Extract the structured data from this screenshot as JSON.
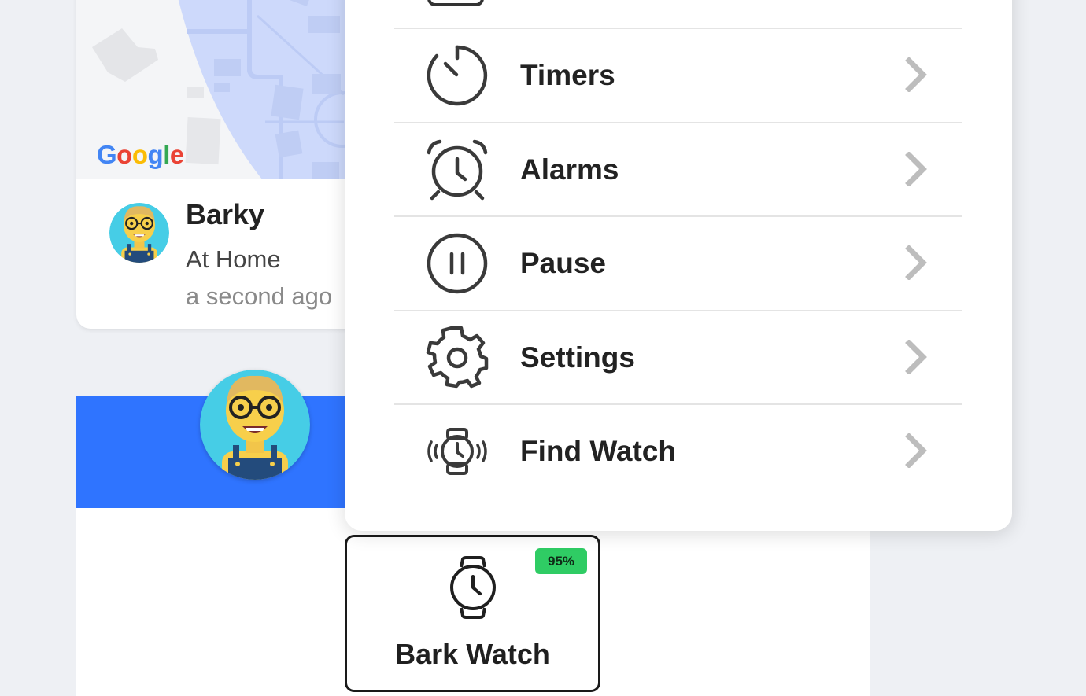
{
  "location_card": {
    "map_provider": "Google",
    "person_name": "Barky",
    "status": "At Home",
    "updated": "a second ago"
  },
  "menu": {
    "items": [
      {
        "label": "Timers",
        "icon": "timer-icon"
      },
      {
        "label": "Alarms",
        "icon": "alarm-clock-icon"
      },
      {
        "label": "Pause",
        "icon": "pause-icon"
      },
      {
        "label": "Settings",
        "icon": "gear-icon"
      },
      {
        "label": "Find Watch",
        "icon": "find-watch-icon"
      }
    ]
  },
  "device": {
    "name": "Bark Watch",
    "battery": "95%",
    "icon": "watch-icon"
  },
  "colors": {
    "banner": "#2f74ff",
    "battery": "#2fcc64",
    "map_overlay": "#cdd9fb"
  }
}
